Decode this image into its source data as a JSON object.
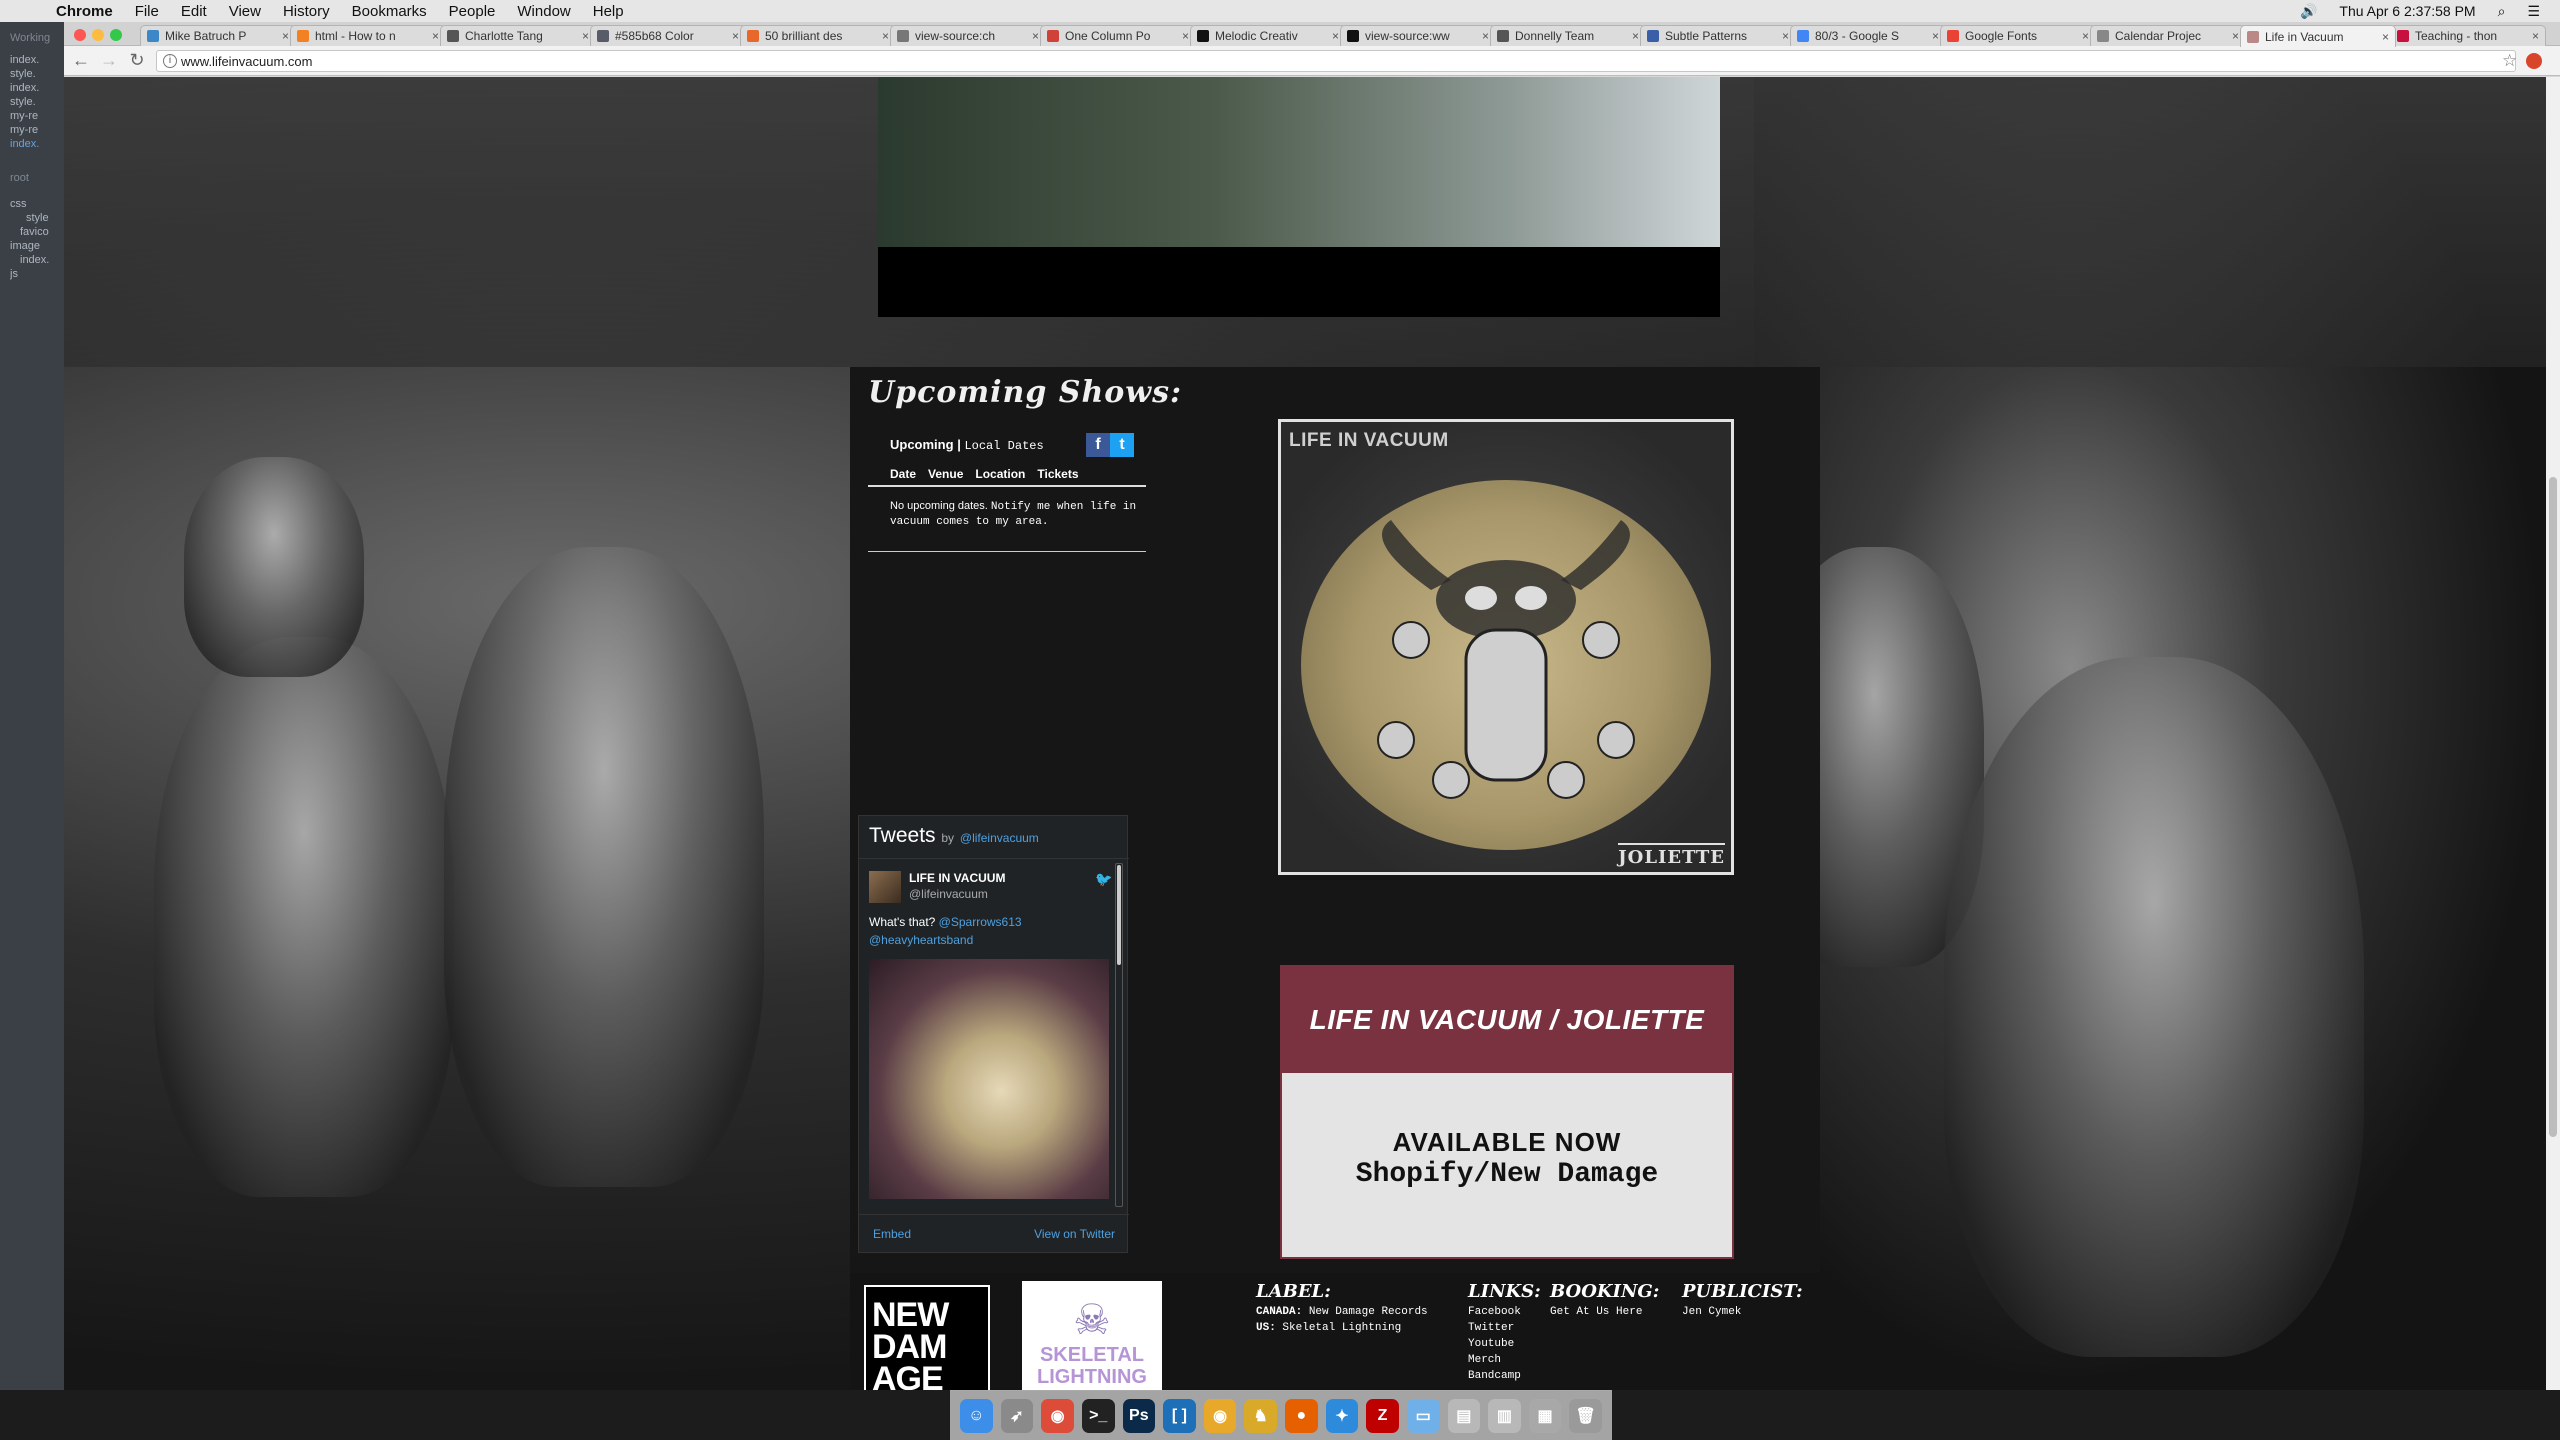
{
  "menubar": {
    "app": "Chrome",
    "items": [
      "File",
      "Edit",
      "View",
      "History",
      "Bookmarks",
      "People",
      "Window",
      "Help"
    ],
    "clock": "Thu Apr 6  2:37:58 PM"
  },
  "editor": {
    "working_label": "Working",
    "files": [
      "index.",
      "style.",
      "index.",
      "style.",
      "my-re",
      "my-re",
      "index."
    ],
    "root_label": "root",
    "tree": [
      "css",
      "style",
      "favico",
      "image",
      "index.",
      "js"
    ]
  },
  "browser": {
    "tabs": [
      {
        "label": "Mike Batruch P",
        "color": "#3b87c8"
      },
      {
        "label": "html - How to n",
        "color": "#f48024"
      },
      {
        "label": "Charlotte Tang",
        "color": "#555555"
      },
      {
        "label": "#585b68 Color",
        "color": "#585b68"
      },
      {
        "label": "50 brilliant des",
        "color": "#e8672a"
      },
      {
        "label": "view-source:ch",
        "color": "#777777"
      },
      {
        "label": "One Column Po",
        "color": "#d0413a"
      },
      {
        "label": "Melodic Creativ",
        "color": "#111111"
      },
      {
        "label": "view-source:ww",
        "color": "#111111"
      },
      {
        "label": "Donnelly Team",
        "color": "#555555"
      },
      {
        "label": "Subtle Patterns",
        "color": "#3a5ea8"
      },
      {
        "label": "80/3 - Google S",
        "color": "#4285f4"
      },
      {
        "label": "Google Fonts",
        "color": "#ea4335"
      },
      {
        "label": "Calendar Projec",
        "color": "#888888"
      },
      {
        "label": "Life in Vacuum",
        "color": "#bb8888"
      },
      {
        "label": "Teaching - thon",
        "color": "#c8103e"
      }
    ],
    "url": "www.lifeinvacuum.com"
  },
  "shows": {
    "title": "Upcoming Shows:",
    "tab_upcoming": "Upcoming",
    "tab_separator": "|",
    "tab_local": "Local Dates",
    "columns": [
      "Date",
      "Venue",
      "Location",
      "Tickets"
    ],
    "empty_message": "No upcoming dates.",
    "notify_link": "Notify me when life in vacuum comes to my area.",
    "facebook_glyph": "f",
    "twitter_glyph": "t"
  },
  "tweets": {
    "title": "Tweets",
    "by": "by",
    "handle_link": "@lifeinvacuum",
    "name": "LIFE IN VACUUM",
    "user": "@lifeinvacuum",
    "text_prefix": "What's that?",
    "mention_1": "@Sparrows613",
    "mention_2": "@heavyheartsband",
    "embed": "Embed",
    "view": "View on Twitter"
  },
  "album": {
    "title": "LIFE IN VACUUM",
    "subtitle": "JOLIETTE"
  },
  "release": {
    "title": "LIFE IN VACUUM / JOLIETTE",
    "available": "AVAILABLE NOW",
    "store": "Shopify/New Damage",
    "accent": "#7b3240"
  },
  "footer": {
    "nd_logo": "NEW DAM AGE",
    "sl_logo": "SKELETAL LIGHTNING",
    "label_title": "LABEL:",
    "label_canada_tag": "CANADA:",
    "label_canada": "New Damage Records",
    "label_us_tag": "US:",
    "label_us": "Skeletal Lightning",
    "links_title": "LINKS:",
    "links": [
      "Facebook",
      "Twitter",
      "Youtube",
      "Merch",
      "Bandcamp"
    ],
    "booking_title": "BOOKING:",
    "booking": "Get At Us Here",
    "publicist_title": "PUBLICIST:",
    "publicist": "Jen Cymek"
  },
  "dock": {
    "icons": [
      {
        "name": "finder-icon",
        "color": "#3d8ee8",
        "glyph": "☺"
      },
      {
        "name": "launchpad-icon",
        "color": "#8a8a8a",
        "glyph": "➶"
      },
      {
        "name": "chrome-icon",
        "color": "#dd4b39",
        "glyph": "◉"
      },
      {
        "name": "terminal-icon",
        "color": "#222222",
        "glyph": ">_"
      },
      {
        "name": "photoshop-icon",
        "color": "#0b2a4a",
        "glyph": "Ps"
      },
      {
        "name": "brackets-icon",
        "color": "#1d6fb8",
        "glyph": "[ ]"
      },
      {
        "name": "chrome-canary-icon",
        "color": "#e8a92b",
        "glyph": "◉"
      },
      {
        "name": "coda-icon",
        "color": "#d9a92a",
        "glyph": "♞"
      },
      {
        "name": "firefox-icon",
        "color": "#e66000",
        "glyph": "●"
      },
      {
        "name": "safari-icon",
        "color": "#2e8bdb",
        "glyph": "✦"
      },
      {
        "name": "filezilla-icon",
        "color": "#bf0000",
        "glyph": "Z"
      },
      {
        "name": "folder-icon",
        "color": "#6fb0e8",
        "glyph": "▭"
      },
      {
        "name": "documents-icon",
        "color": "#b8b8b8",
        "glyph": "▤"
      },
      {
        "name": "downloads-icon",
        "color": "#b8b8b8",
        "glyph": "▥"
      },
      {
        "name": "stack-icon",
        "color": "#a8a8a8",
        "glyph": "▦"
      },
      {
        "name": "trash-icon",
        "color": "#9a9a9a",
        "glyph": "🗑"
      }
    ]
  }
}
